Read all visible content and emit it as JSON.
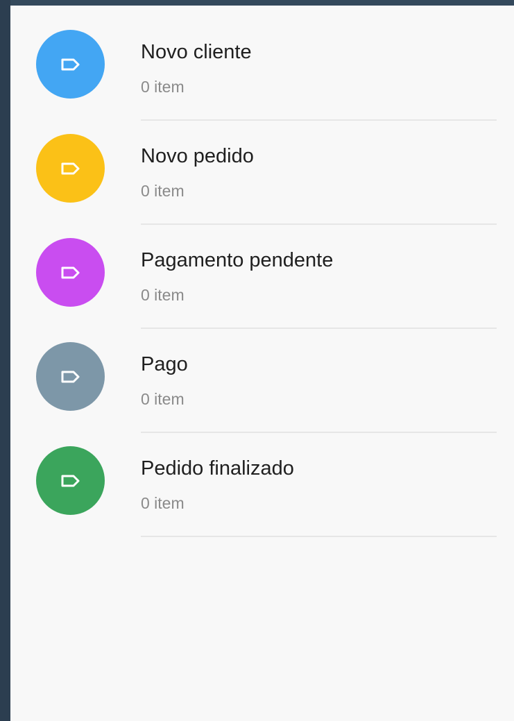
{
  "labels": [
    {
      "title": "Novo cliente",
      "count": "0 item",
      "color": "#43a6f3",
      "icon": "label-tag-icon"
    },
    {
      "title": "Novo pedido",
      "count": "0 item",
      "color": "#fbc117",
      "icon": "label-tag-icon"
    },
    {
      "title": "Pagamento pendente",
      "count": "0 item",
      "color": "#c94df0",
      "icon": "label-tag-icon"
    },
    {
      "title": "Pago",
      "count": "0 item",
      "color": "#7d97a8",
      "icon": "label-tag-icon"
    },
    {
      "title": "Pedido finalizado",
      "count": "0 item",
      "color": "#3ba55c",
      "icon": "label-tag-icon"
    }
  ]
}
